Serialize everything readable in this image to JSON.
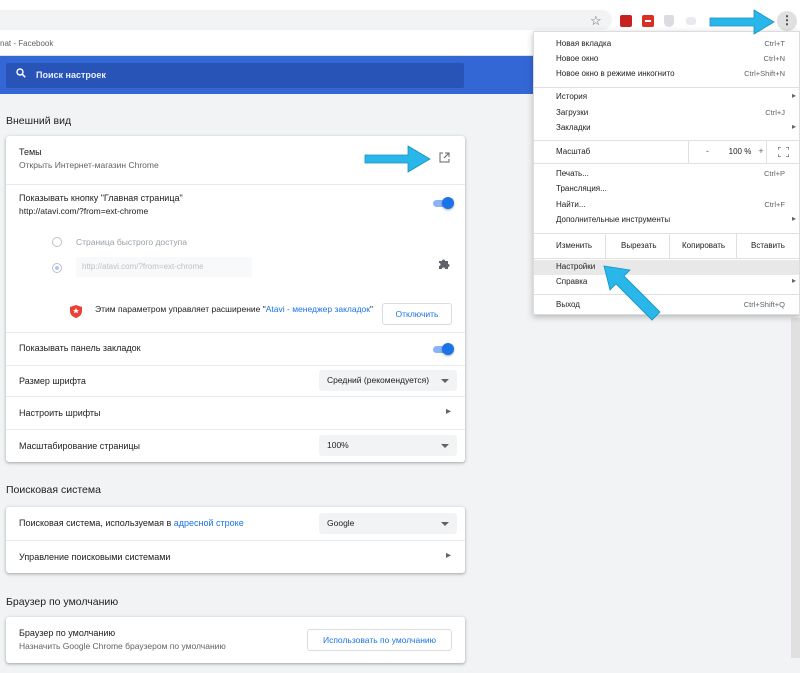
{
  "browser": {
    "bookmark_text": "nat - Facebook"
  },
  "search": {
    "placeholder": "Поиск настроек"
  },
  "appearance": {
    "title": "Внешний вид",
    "themes_label": "Темы",
    "themes_sub": "Открыть Интернет-магазин Chrome",
    "home_button_label": "Показывать кнопку \"Главная страница\"",
    "home_button_url": "http://atavi.com/?from=ext-chrome",
    "home_button_enabled": true,
    "radio_ntp": "Страница быстрого доступа",
    "radio_url_value": "http://atavi.com/?from=ext-chrome",
    "ext_notice_prefix": "Этим параметром управляет расширение \"",
    "ext_notice_link": "Atavi - менеджер закладок",
    "ext_notice_suffix": "\"",
    "disable_button": "Отключить",
    "bookmarks_bar_label": "Показывать панель закладок",
    "bookmarks_bar_enabled": true,
    "font_size_label": "Размер шрифта",
    "font_size_value": "Средний (рекомендуется)",
    "custom_fonts_label": "Настроить шрифты",
    "page_zoom_label": "Масштабирование страницы",
    "page_zoom_value": "100%"
  },
  "search_engine": {
    "title": "Поисковая система",
    "engine_prefix": "Поисковая система, используемая в ",
    "engine_link": "адресной строке",
    "engine_value": "Google",
    "manage_label": "Управление поисковыми системами"
  },
  "default_browser": {
    "title": "Браузер по умолчанию",
    "label": "Браузер по умолчанию",
    "sub": "Назначить Google Chrome браузером по умолчанию",
    "button": "Использовать по умолчанию"
  },
  "menu": {
    "new_tab": "Новая вкладка",
    "new_tab_key": "Ctrl+T",
    "new_window": "Новое окно",
    "new_window_key": "Ctrl+N",
    "incognito": "Новое окно в режиме инкогнито",
    "incognito_key": "Ctrl+Shift+N",
    "history": "История",
    "downloads": "Загрузки",
    "downloads_key": "Ctrl+J",
    "bookmarks": "Закладки",
    "zoom_label": "Масштаб",
    "zoom_minus": "-",
    "zoom_value": "100 %",
    "zoom_plus": "+",
    "print": "Печать...",
    "print_key": "Ctrl+P",
    "cast": "Трансляция...",
    "find": "Найти...",
    "find_key": "Ctrl+F",
    "more_tools": "Дополнительные инструменты",
    "edit": "Изменить",
    "cut": "Вырезать",
    "copy": "Копировать",
    "paste": "Вставить",
    "settings": "Настройки",
    "help": "Справка",
    "exit": "Выход",
    "exit_key": "Ctrl+Shift+Q"
  },
  "colors": {
    "header_blue": "#3367d6",
    "accent_blue": "#1a73e8",
    "arrow_cyan": "#29b6e8"
  }
}
